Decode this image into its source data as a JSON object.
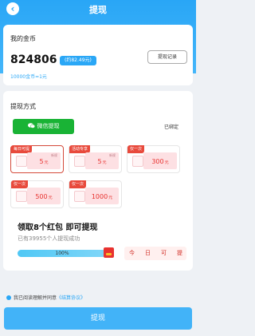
{
  "header": {
    "title": "提现",
    "back_icon": "chevron-left-icon"
  },
  "coins": {
    "label": "我的金币",
    "amount": "824806",
    "approx": "(约82.49元)",
    "record_label": "提现记录",
    "rate": "10000金币=1元"
  },
  "withdraw": {
    "label": "提现方式",
    "wechat_label": "微信提现",
    "wechat_icon": "wechat-icon",
    "bound_label": "已绑定",
    "options": [
      {
        "tag": "每日可提",
        "value": "5",
        "unit": "元",
        "tip": "新规",
        "selected": true
      },
      {
        "tag": "活动专享",
        "value": "5",
        "unit": "元",
        "tip": "新规",
        "selected": false
      },
      {
        "tag": "仅一次",
        "value": "300",
        "unit": "元",
        "tip": "",
        "selected": false
      },
      {
        "tag": "仅一次",
        "value": "500",
        "unit": "元",
        "tip": "",
        "selected": false
      },
      {
        "tag": "仅一次",
        "value": "1000",
        "unit": "元",
        "tip": "",
        "selected": false
      }
    ]
  },
  "promo": {
    "headline": "领取8个红包 即可提现",
    "sub": "已有39955个人提现成功",
    "progress": {
      "text": "100%",
      "value": 1.0
    },
    "chars": [
      "今",
      "日",
      "可",
      "提"
    ]
  },
  "agreement": {
    "text": "我已阅读理解并同意",
    "link": "《结算协议》"
  },
  "submit_label": "提现",
  "colors": {
    "primary": "#2aa7f6",
    "wechat_green": "#19b335",
    "accent_red": "#e8322f"
  }
}
